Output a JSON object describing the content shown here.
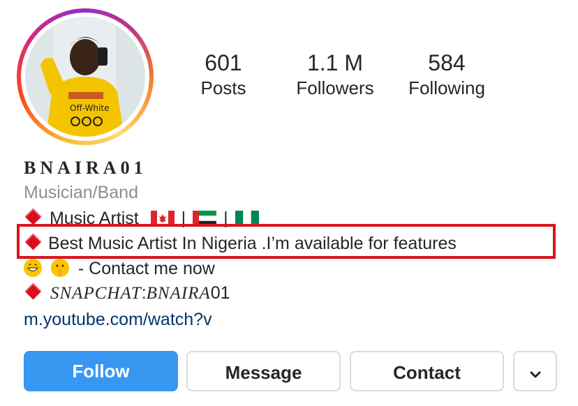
{
  "profile": {
    "username": "BNAIRA01",
    "category": "Musician/Band",
    "stats": {
      "posts_count": "601",
      "posts_label": "Posts",
      "followers_count": "1.1 M",
      "followers_label": "Followers",
      "following_count": "584",
      "following_label": "Following"
    },
    "bio": {
      "line1_text": "Music Artist",
      "sep1": "|",
      "sep2": "|",
      "line2_text": "Best Music Artist In Nigeria .I’m available for features",
      "line3_text": "- Contact me now",
      "line4_prefix": "SNAPCHAT",
      "line4_colon": ":",
      "line4_name": "BNAIRA",
      "line4_suffix": "01"
    },
    "link": "m.youtube.com/watch?v"
  },
  "actions": {
    "follow_label": "Follow",
    "message_label": "Message",
    "contact_label": "Contact"
  },
  "colors": {
    "follow_button": "#3897f0",
    "highlight_box": "#d9151e",
    "diamond": "#d90f1f",
    "link": "#00376b",
    "category": "#8e8e8e"
  },
  "icons": {
    "diamond": "red-diamond-icon",
    "flag_1": "canada-flag-icon",
    "flag_2": "uae-flag-icon",
    "flag_3": "nigeria-flag-icon",
    "emoji_1": "grinning-face-icon",
    "emoji_2": "shushing-face-icon",
    "more": "chevron-down-icon"
  }
}
